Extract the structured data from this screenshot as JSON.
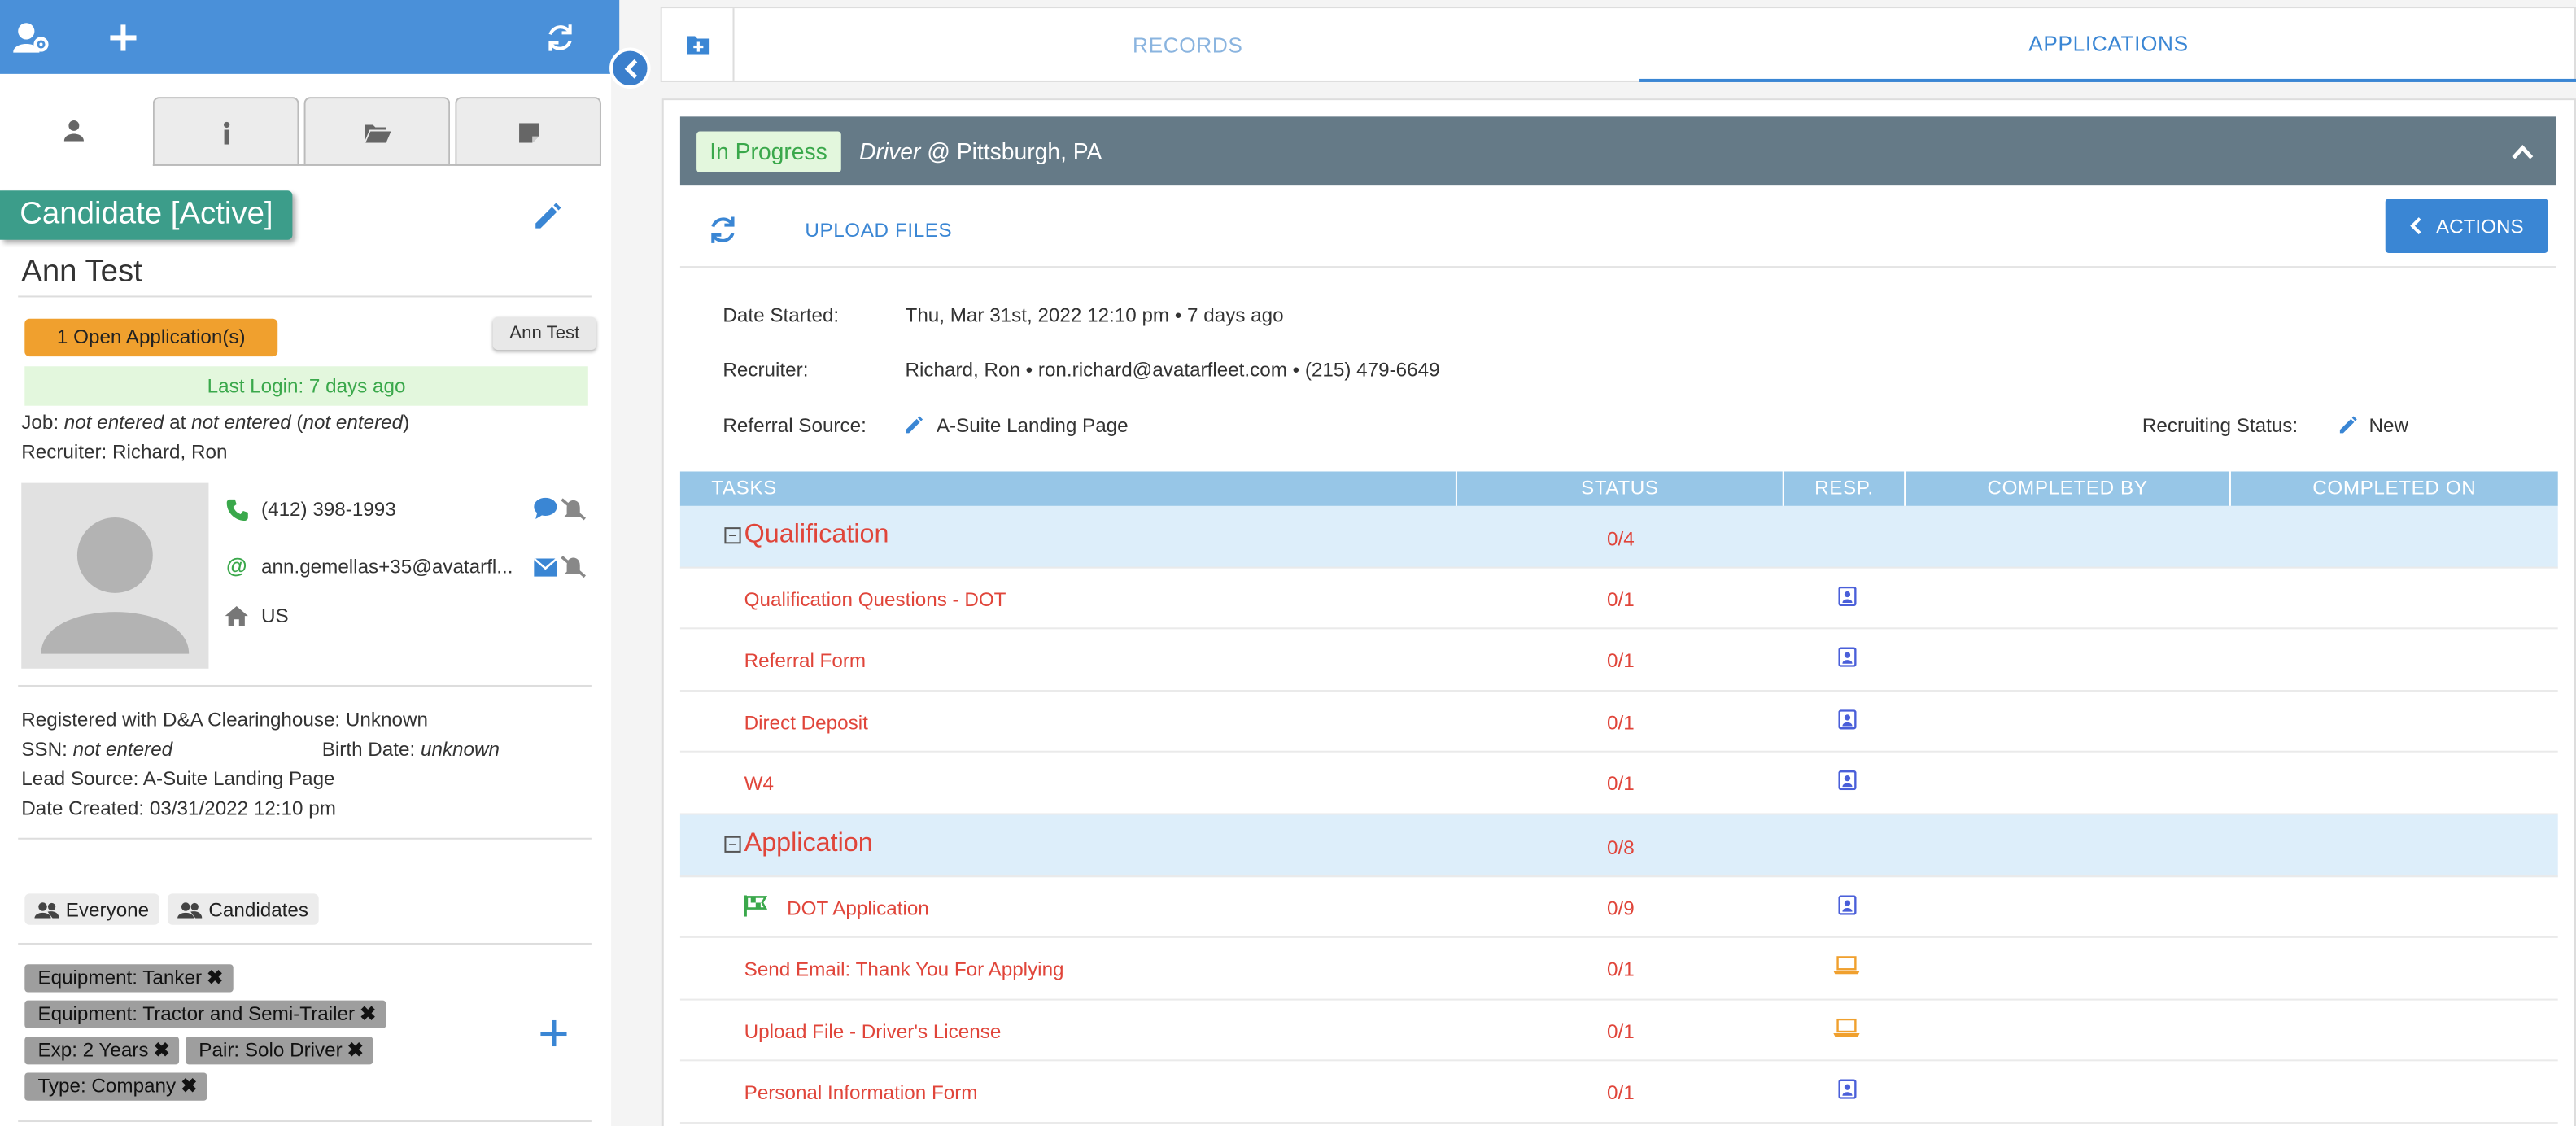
{
  "left": {
    "status_label": "Candidate [Active]",
    "candidate_name": "Ann Test",
    "open_apps_label": "1 Open Application(s)",
    "name_chip": "Ann  Test",
    "last_login": "Last Login: 7 days ago",
    "job_label": "Job:",
    "job_value_1": "not entered",
    "job_at": " at ",
    "job_value_2": "not entered",
    "job_value_3": "not entered",
    "recruiter_label": "Recruiter:",
    "recruiter_value": "Richard, Ron",
    "phone": "(412) 398-1993",
    "email": "ann.gemellas+35@avatarfl...",
    "country": "US",
    "clearinghouse_label": "Registered with D&A Clearinghouse:",
    "clearinghouse_value": "Unknown",
    "ssn_label": "SSN:",
    "ssn_value": "not entered",
    "birth_label": "Birth Date:",
    "birth_value": "unknown",
    "lead_source_label": "Lead Source:",
    "lead_source_value": "A-Suite Landing Page",
    "date_created_label": "Date Created:",
    "date_created_value": "03/31/2022 12:10 pm",
    "groups": [
      "Everyone",
      "Candidates"
    ],
    "tags": [
      "Equipment: Tanker",
      "Equipment: Tractor and Semi-Trailer",
      "Exp: 2 Years",
      "Pair: Solo Driver",
      "Type: Company"
    ],
    "tag_remove": "✖"
  },
  "right": {
    "tabs": [
      "RECORDS",
      "APPLICATIONS"
    ],
    "status_badge": "In Progress",
    "job_role": "Driver",
    "job_location": "@ Pittsburgh, PA",
    "upload_label": "UPLOAD FILES",
    "actions_label": "ACTIONS",
    "date_started_label": "Date Started:",
    "date_started_value": "Thu, Mar 31st, 2022 12:10 pm • 7 days ago",
    "recruiter_label": "Recruiter:",
    "recruiter_value": "Richard, Ron • ron.richard@avatarfleet.com • (215) 479-6649",
    "referral_label": "Referral Source:",
    "referral_value": "A-Suite Landing Page",
    "recruiting_status_label": "Recruiting Status:",
    "recruiting_status_value": "New",
    "columns": [
      "TASKS",
      "STATUS",
      "RESP.",
      "COMPLETED BY",
      "COMPLETED ON"
    ],
    "expand_symbol": "−",
    "tasks": [
      {
        "name": "Qualification",
        "status": "0/4",
        "group": true
      },
      {
        "name": "Qualification Questions - DOT",
        "status": "0/1",
        "resp": "contact-card-icon"
      },
      {
        "name": "Referral Form",
        "status": "0/1",
        "resp": "contact-card-icon"
      },
      {
        "name": "Direct Deposit",
        "status": "0/1",
        "resp": "contact-card-icon"
      },
      {
        "name": "W4",
        "status": "0/1",
        "resp": "contact-card-icon"
      },
      {
        "name": "Application",
        "status": "0/8",
        "group": true
      },
      {
        "name": "DOT Application",
        "status": "0/9",
        "resp": "contact-card-icon",
        "flag": true
      },
      {
        "name": "Send Email: Thank You For Applying",
        "status": "0/1",
        "resp": "laptop-icon"
      },
      {
        "name": "Upload File - Driver's License",
        "status": "0/1",
        "resp": "laptop-icon"
      },
      {
        "name": "Personal Information Form",
        "status": "0/1",
        "resp": "contact-card-icon"
      }
    ]
  },
  "colors": {
    "accent": "#4a90d9",
    "teal": "#3c9d8a",
    "orange": "#f0a02e",
    "task_red": "#e0453a",
    "header_slate": "#657a87"
  }
}
